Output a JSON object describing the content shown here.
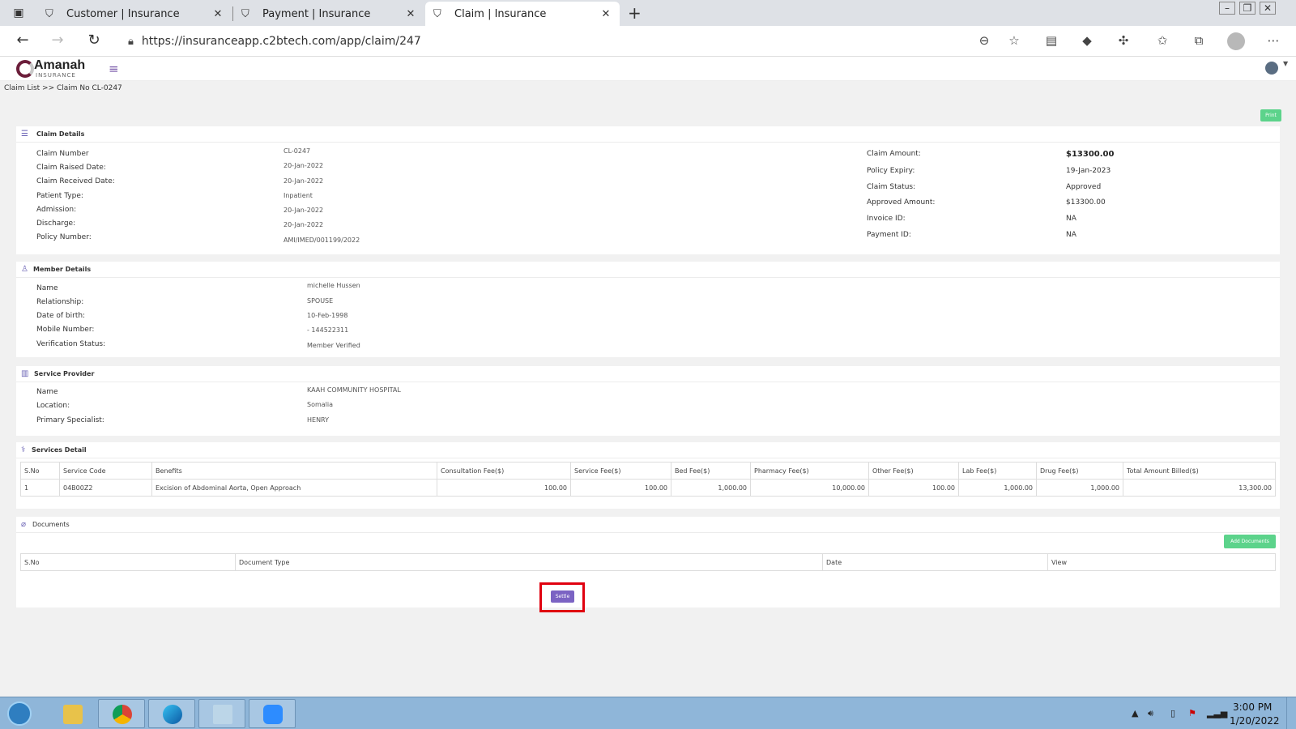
{
  "browser": {
    "tabs": [
      {
        "title": "Customer | Insurance",
        "icon": "shield-icon",
        "active": false
      },
      {
        "title": "Payment | Insurance",
        "icon": "shield-icon",
        "active": false
      },
      {
        "title": "Claim | Insurance",
        "icon": "shield-icon",
        "active": true
      }
    ],
    "url": "https://insuranceapp.c2btech.com/app/claim/247"
  },
  "app": {
    "logo_text": "Amanah",
    "logo_sub": "INSURANCE"
  },
  "breadcrumb": "Claim List >> Claim No CL-0247",
  "print_label": "Print",
  "claim_details": {
    "title": "Claim Details",
    "left": [
      {
        "label": "Claim Number",
        "value": "CL-0247"
      },
      {
        "label": "Claim Raised Date:",
        "value": "20-Jan-2022"
      },
      {
        "label": "Claim Received Date:",
        "value": "20-Jan-2022"
      },
      {
        "label": "Patient Type:",
        "value": "Inpatient"
      },
      {
        "label": "Admission:",
        "value": "20-Jan-2022"
      },
      {
        "label": "Discharge:",
        "value": "20-Jan-2022"
      },
      {
        "label": "Policy Number:",
        "value": "AMI/IMED/001199/2022"
      }
    ],
    "right": [
      {
        "label": "Claim Amount:",
        "value": "$13300.00"
      },
      {
        "label": "Policy Expiry:",
        "value": "19-Jan-2023"
      },
      {
        "label": "Claim Status:",
        "value": "Approved"
      },
      {
        "label": "Approved Amount:",
        "value": "$13300.00"
      },
      {
        "label": "Invoice ID:",
        "value": "NA"
      },
      {
        "label": "Payment ID:",
        "value": "NA"
      }
    ]
  },
  "member_details": {
    "title": "Member Details",
    "rows": [
      {
        "label": "Name",
        "value": "michelle Hussen"
      },
      {
        "label": "Relationship:",
        "value": "SPOUSE"
      },
      {
        "label": "Date of birth:",
        "value": "10-Feb-1998"
      },
      {
        "label": "Mobile Number:",
        "value": "- 144522311"
      },
      {
        "label": "Verification Status:",
        "value": "Member Verified"
      }
    ]
  },
  "service_provider": {
    "title": "Service Provider",
    "rows": [
      {
        "label": "Name",
        "value": "KAAH COMMUNITY HOSPITAL"
      },
      {
        "label": "Location:",
        "value": "Somalia"
      },
      {
        "label": "Primary Specialist:",
        "value": "HENRY"
      }
    ]
  },
  "services_detail": {
    "title": "Services Detail",
    "headers": [
      "S.No",
      "Service Code",
      "Benefits",
      "Consultation Fee($)",
      "Service Fee($)",
      "Bed Fee($)",
      "Pharmacy Fee($)",
      "Other Fee($)",
      "Lab Fee($)",
      "Drug Fee($)",
      "Total Amount Billed($)"
    ],
    "rows": [
      [
        "1",
        "04B00Z2",
        "Excision of Abdominal Aorta, Open Approach",
        "100.00",
        "100.00",
        "1,000.00",
        "10,000.00",
        "100.00",
        "1,000.00",
        "1,000.00",
        "13,300.00"
      ]
    ]
  },
  "documents": {
    "title": "Documents",
    "add_label": "Add Documents",
    "headers": [
      "S.No",
      "Document Type",
      "Date",
      "View"
    ]
  },
  "settle_label": "Settle",
  "taskbar": {
    "apps": [
      "file-explorer-icon",
      "chrome-icon",
      "edge-icon",
      "notepad-icon",
      "zoom-icon"
    ],
    "time": "3:00 PM",
    "date": "1/20/2022"
  }
}
